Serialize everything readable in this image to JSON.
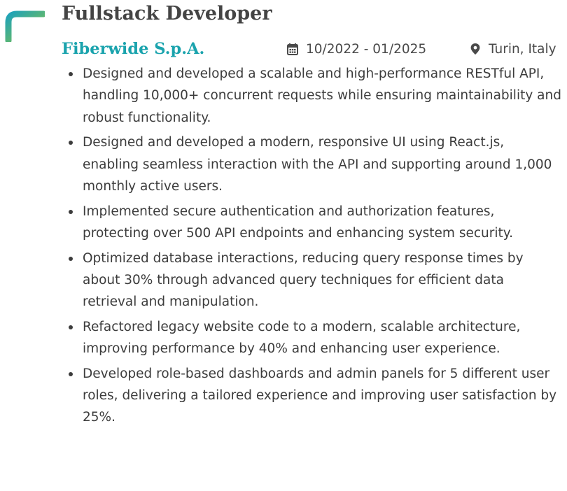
{
  "job": {
    "title": "Fullstack Developer",
    "company": "Fiberwide S.p.A.",
    "dates": "10/2022 - 01/2025",
    "location": "Turin, Italy",
    "bullets": [
      "Designed and developed a scalable and high-performance RESTful API, handling 10,000+ concurrent requests while ensuring maintainability and robust functionality.",
      "Designed and developed a modern, responsive UI using React.js, enabling seamless interaction with the API and supporting around 1,000 monthly active users.",
      "Implemented secure authentication and authorization features, protecting over 500 API endpoints and enhancing system security.",
      "Optimized database interactions, reducing query response times by about 30% through advanced query techniques for efficient data retrieval and manipulation.",
      "Refactored legacy website code to a modern, scalable architecture, improving performance by 40% and enhancing user experience.",
      "Developed role-based dashboards and admin panels for 5 different user roles, delivering a tailored experience and improving user satisfaction by 25%."
    ]
  },
  "icons": {
    "dates": "calendar-icon",
    "location": "map-marker-icon"
  },
  "colors": {
    "company": "#1aa3ad",
    "accent_top": "#1fa2b8",
    "accent_bottom": "#8cc63f",
    "title": "#444444",
    "body_text": "#3c3c3c"
  }
}
